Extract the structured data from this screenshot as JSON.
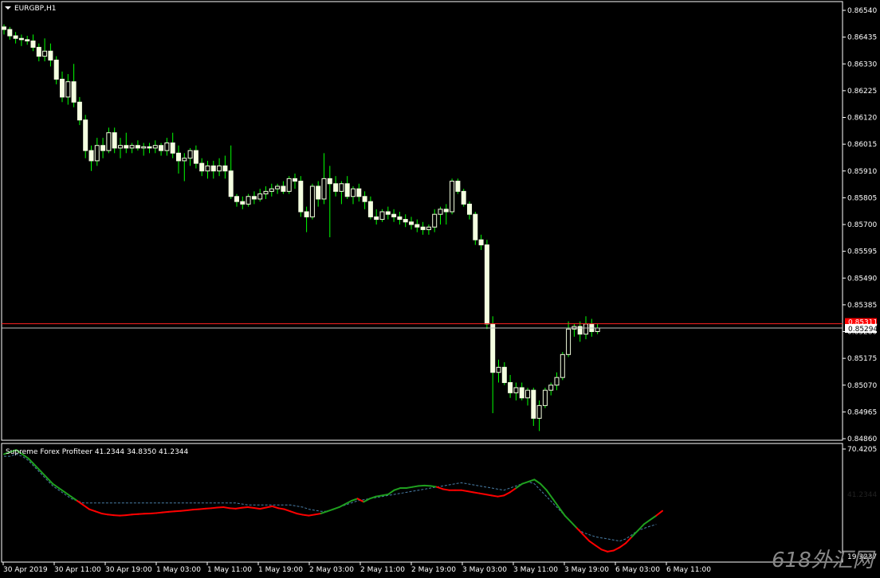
{
  "window": {
    "symbol_label": "EURGBP,H1"
  },
  "indicator": {
    "label": "Supreme Forex Profiteer 41.2344 34.8350 41.2344"
  },
  "colors": {
    "bull": "#00ff00",
    "candle_body": "#f4ffe0",
    "price_line": "#ff0000",
    "indicator_down": "#ff0000",
    "indicator_up": "#1fa01f",
    "indicator_dotted": "#4a7fa8",
    "axis": "#ffffff"
  },
  "price_axis": {
    "ticks": [
      "0.86540",
      "0.86435",
      "0.86330",
      "0.86225",
      "0.86120",
      "0.86015",
      "0.85910",
      "0.85805",
      "0.85700",
      "0.85595",
      "0.85490",
      "0.85385",
      "0.85280",
      "0.85175",
      "0.85070",
      "0.84965",
      "0.84860"
    ],
    "min": 0.8486,
    "max": 0.8654
  },
  "current_price": {
    "bid": "0.85294",
    "ask": "0.85311"
  },
  "indicator_axis": {
    "top": "70.4205",
    "bottom": "19.3237",
    "current": "41.2344"
  },
  "time_axis": {
    "labels": [
      "30 Apr 2019",
      "30 Apr 11:00",
      "30 Apr 19:00",
      "1 May 03:00",
      "1 May 11:00",
      "1 May 19:00",
      "2 May 03:00",
      "2 May 11:00",
      "2 May 19:00",
      "3 May 03:00",
      "3 May 11:00",
      "3 May 19:00",
      "6 May 03:00",
      "6 May 11:00"
    ]
  },
  "watermark": {
    "text": "618外汇网"
  },
  "chart_data": {
    "type": "candlestick",
    "ylim": [
      0.8486,
      0.8654
    ],
    "candles": [
      [
        0.86475,
        0.86485,
        0.86445,
        0.86465
      ],
      [
        0.86465,
        0.86475,
        0.86425,
        0.8644
      ],
      [
        0.8644,
        0.86455,
        0.8641,
        0.8643
      ],
      [
        0.8643,
        0.86445,
        0.864,
        0.86425
      ],
      [
        0.86425,
        0.8644,
        0.86405,
        0.8642
      ],
      [
        0.8642,
        0.86445,
        0.8638,
        0.86395
      ],
      [
        0.86395,
        0.8641,
        0.8634,
        0.8636
      ],
      [
        0.8636,
        0.8643,
        0.8634,
        0.8638
      ],
      [
        0.8638,
        0.8641,
        0.8632,
        0.86345
      ],
      [
        0.86345,
        0.8636,
        0.8625,
        0.8627
      ],
      [
        0.8627,
        0.863,
        0.8618,
        0.862
      ],
      [
        0.862,
        0.8629,
        0.8617,
        0.8626
      ],
      [
        0.8626,
        0.8633,
        0.8616,
        0.8618
      ],
      [
        0.8618,
        0.862,
        0.8609,
        0.8611
      ],
      [
        0.8611,
        0.8613,
        0.8596,
        0.8599
      ],
      [
        0.8599,
        0.8601,
        0.8591,
        0.8595
      ],
      [
        0.8595,
        0.8604,
        0.8593,
        0.8601
      ],
      [
        0.8601,
        0.8604,
        0.8596,
        0.8599
      ],
      [
        0.8599,
        0.8608,
        0.8598,
        0.8606
      ],
      [
        0.8606,
        0.8608,
        0.8598,
        0.86
      ],
      [
        0.86,
        0.8604,
        0.8596,
        0.8601
      ],
      [
        0.8601,
        0.8606,
        0.8598,
        0.86
      ],
      [
        0.86,
        0.8602,
        0.8598,
        0.8601
      ],
      [
        0.8601,
        0.8603,
        0.8599,
        0.86
      ],
      [
        0.86,
        0.8602,
        0.8597,
        0.86005
      ],
      [
        0.86005,
        0.8602,
        0.8598,
        0.86
      ],
      [
        0.86,
        0.8603,
        0.8598,
        0.8601
      ],
      [
        0.8601,
        0.8602,
        0.8597,
        0.8599
      ],
      [
        0.8599,
        0.8604,
        0.8597,
        0.8602
      ],
      [
        0.8602,
        0.8606,
        0.8596,
        0.8598
      ],
      [
        0.8598,
        0.8601,
        0.859,
        0.8595
      ],
      [
        0.8595,
        0.8598,
        0.8587,
        0.8596
      ],
      [
        0.8596,
        0.86,
        0.8593,
        0.8599
      ],
      [
        0.8599,
        0.8601,
        0.8592,
        0.8594
      ],
      [
        0.8594,
        0.8596,
        0.8589,
        0.8591
      ],
      [
        0.8591,
        0.8595,
        0.8588,
        0.8593
      ],
      [
        0.8593,
        0.8595,
        0.8588,
        0.8591
      ],
      [
        0.8591,
        0.8596,
        0.8589,
        0.8593
      ],
      [
        0.8593,
        0.8597,
        0.8588,
        0.8591
      ],
      [
        0.8591,
        0.8601,
        0.858,
        0.8581
      ],
      [
        0.8581,
        0.8582,
        0.8577,
        0.8579
      ],
      [
        0.8579,
        0.8581,
        0.8576,
        0.8578
      ],
      [
        0.8578,
        0.8582,
        0.8577,
        0.8581
      ],
      [
        0.8581,
        0.8583,
        0.8578,
        0.858
      ],
      [
        0.858,
        0.8584,
        0.8579,
        0.8582
      ],
      [
        0.8582,
        0.8585,
        0.858,
        0.8583
      ],
      [
        0.8583,
        0.8586,
        0.8581,
        0.8584
      ],
      [
        0.8584,
        0.8586,
        0.8582,
        0.8585
      ],
      [
        0.8585,
        0.8587,
        0.8582,
        0.8583
      ],
      [
        0.8583,
        0.8589,
        0.8582,
        0.8588
      ],
      [
        0.8588,
        0.859,
        0.8584,
        0.8587
      ],
      [
        0.8587,
        0.8589,
        0.8573,
        0.8575
      ],
      [
        0.8575,
        0.8577,
        0.8567,
        0.8573
      ],
      [
        0.8573,
        0.8586,
        0.8572,
        0.8585
      ],
      [
        0.8585,
        0.8587,
        0.8577,
        0.858
      ],
      [
        0.858,
        0.8598,
        0.8578,
        0.8588
      ],
      [
        0.8588,
        0.8593,
        0.8565,
        0.8586
      ],
      [
        0.8586,
        0.8589,
        0.8581,
        0.8583
      ],
      [
        0.8583,
        0.8587,
        0.8578,
        0.8586
      ],
      [
        0.8586,
        0.8589,
        0.858,
        0.8581
      ],
      [
        0.8581,
        0.8585,
        0.8578,
        0.8584
      ],
      [
        0.8584,
        0.8586,
        0.8579,
        0.8581
      ],
      [
        0.8581,
        0.8583,
        0.8576,
        0.8579
      ],
      [
        0.8579,
        0.8581,
        0.8572,
        0.8573
      ],
      [
        0.8573,
        0.8576,
        0.857,
        0.8572
      ],
      [
        0.8572,
        0.8576,
        0.8571,
        0.8575
      ],
      [
        0.8575,
        0.8577,
        0.8572,
        0.8574
      ],
      [
        0.8574,
        0.8576,
        0.8571,
        0.8573
      ],
      [
        0.8573,
        0.8575,
        0.857,
        0.8572
      ],
      [
        0.8572,
        0.8574,
        0.8569,
        0.8571
      ],
      [
        0.8571,
        0.8573,
        0.8568,
        0.857
      ],
      [
        0.857,
        0.8572,
        0.8567,
        0.8569
      ],
      [
        0.8569,
        0.8571,
        0.8566,
        0.8568
      ],
      [
        0.8568,
        0.857,
        0.8566,
        0.8569
      ],
      [
        0.8569,
        0.8576,
        0.8567,
        0.8574
      ],
      [
        0.8574,
        0.8577,
        0.857,
        0.8576
      ],
      [
        0.8576,
        0.8578,
        0.857,
        0.8575
      ],
      [
        0.8575,
        0.8588,
        0.8574,
        0.8587
      ],
      [
        0.8587,
        0.8588,
        0.8582,
        0.8583
      ],
      [
        0.8583,
        0.8584,
        0.8577,
        0.8578
      ],
      [
        0.8578,
        0.8579,
        0.8572,
        0.8574
      ],
      [
        0.8574,
        0.8575,
        0.8562,
        0.8564
      ],
      [
        0.8564,
        0.8566,
        0.856,
        0.8562
      ],
      [
        0.8562,
        0.8564,
        0.8529,
        0.8531
      ],
      [
        0.8531,
        0.8534,
        0.8496,
        0.8512
      ],
      [
        0.8512,
        0.8517,
        0.8508,
        0.8514
      ],
      [
        0.8514,
        0.8516,
        0.8507,
        0.8508
      ],
      [
        0.8508,
        0.8511,
        0.8502,
        0.8504
      ],
      [
        0.8504,
        0.8508,
        0.8501,
        0.8506
      ],
      [
        0.8506,
        0.8508,
        0.8501,
        0.8502
      ],
      [
        0.8502,
        0.8506,
        0.8499,
        0.8505
      ],
      [
        0.8505,
        0.8506,
        0.8491,
        0.8494
      ],
      [
        0.8494,
        0.8501,
        0.8489,
        0.8499
      ],
      [
        0.8499,
        0.8506,
        0.8498,
        0.8505
      ],
      [
        0.8505,
        0.8508,
        0.8503,
        0.8507
      ],
      [
        0.8507,
        0.8512,
        0.8505,
        0.851
      ],
      [
        0.851,
        0.852,
        0.8509,
        0.8519
      ],
      [
        0.8519,
        0.8532,
        0.8518,
        0.8529
      ],
      [
        0.8529,
        0.8531,
        0.8526,
        0.853
      ],
      [
        0.853,
        0.8532,
        0.8524,
        0.8527
      ],
      [
        0.8527,
        0.8534,
        0.8525,
        0.8531
      ],
      [
        0.8531,
        0.8533,
        0.8526,
        0.8528
      ],
      [
        0.8528,
        0.8531,
        0.8527,
        0.85294
      ]
    ],
    "indicator_main": [
      68,
      69,
      70,
      68,
      66,
      63,
      60,
      57,
      54,
      52,
      50,
      48,
      46,
      44,
      42,
      41,
      40,
      39.5,
      39.2,
      39,
      39.2,
      39.5,
      39.7,
      39.9,
      40,
      40.2,
      40.5,
      40.8,
      41,
      41.2,
      41.5,
      41.8,
      42,
      42.3,
      42.5,
      42.8,
      43,
      42.5,
      42.3,
      42.7,
      43,
      42.6,
      42.2,
      42.8,
      43.4,
      42.5,
      42,
      41,
      40,
      39.4,
      39,
      39.5,
      40,
      41,
      42,
      43,
      44.5,
      46,
      47,
      45.5,
      47,
      48,
      48.5,
      49,
      51,
      52,
      52,
      52.5,
      53,
      53.2,
      53,
      52.5,
      51.5,
      51,
      51,
      51,
      50.5,
      50,
      49.5,
      49,
      48.5,
      48,
      48.5,
      50,
      52,
      54,
      55,
      56,
      54,
      51,
      47,
      43,
      39,
      36,
      33,
      30,
      27,
      25,
      23,
      22,
      22.5,
      24,
      26,
      29,
      32,
      35,
      37,
      39,
      41.2344
    ],
    "indicator_signal": [
      67,
      67,
      68,
      67,
      65,
      62,
      59,
      56,
      53,
      51,
      49,
      47,
      46,
      45,
      45,
      45,
      45,
      45,
      45,
      45,
      45,
      45,
      45,
      45,
      45,
      45,
      45,
      45,
      45,
      45,
      45,
      45,
      45,
      45,
      45,
      45,
      45,
      45,
      45,
      44.5,
      44,
      44,
      44,
      44,
      44,
      44,
      44,
      44,
      43.5,
      43,
      42,
      41.5,
      41,
      41,
      42,
      43,
      44,
      45,
      46,
      46.5,
      47,
      47.5,
      48,
      48.5,
      49,
      49.5,
      50,
      50.5,
      51,
      51.5,
      52,
      52.5,
      53,
      53.5,
      54,
      54.5,
      54,
      53.5,
      53,
      52.5,
      52,
      51.5,
      51,
      52,
      53,
      54,
      55,
      54,
      51,
      48,
      45,
      42,
      39,
      36,
      33,
      31,
      30,
      29,
      28.5,
      28,
      27.5,
      27,
      28,
      30,
      32,
      33,
      34,
      34.835
    ]
  }
}
